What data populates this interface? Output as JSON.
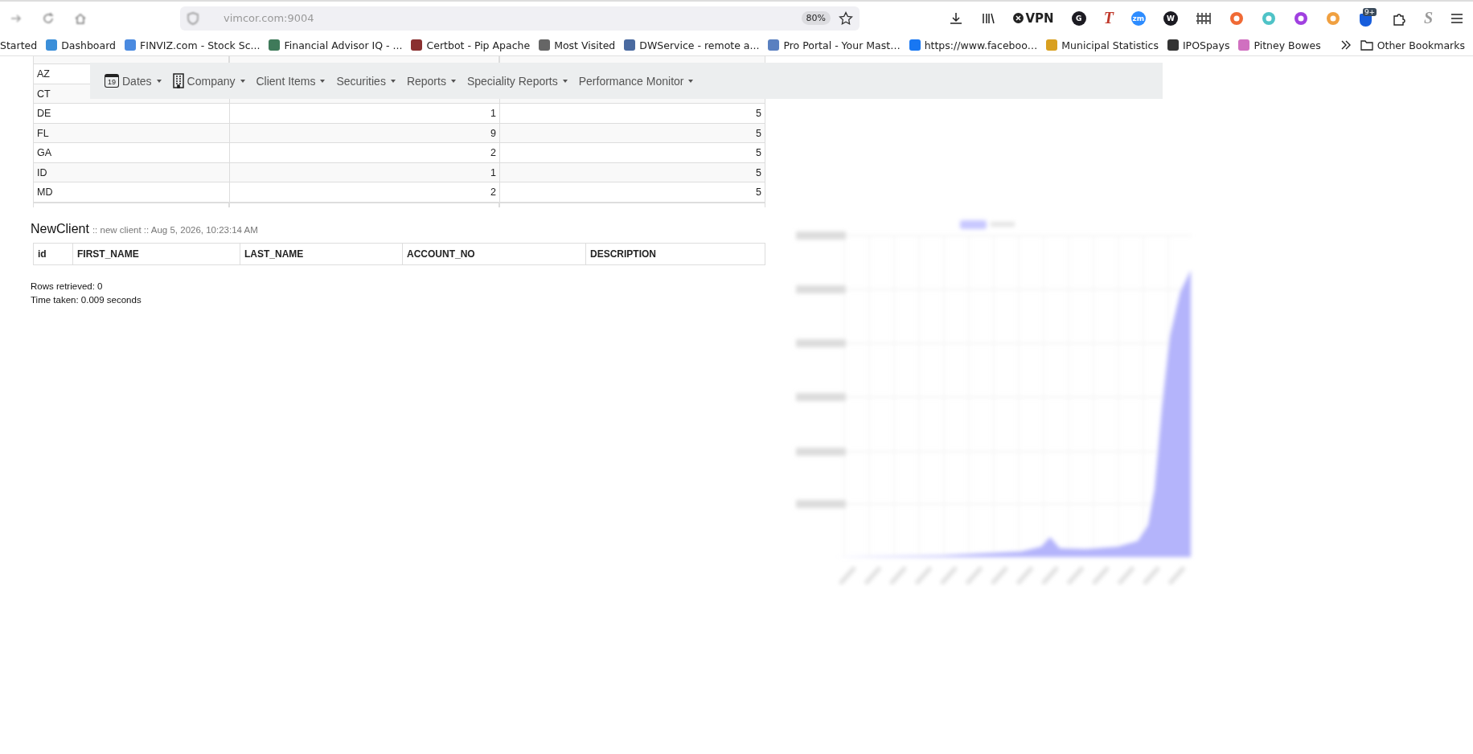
{
  "browser": {
    "address": "vimcor.com:9004",
    "zoom": "80%",
    "extensions": [
      {
        "kind": "download"
      },
      {
        "kind": "library"
      },
      {
        "kind": "vpn",
        "label": "VPN"
      },
      {
        "kind": "letter",
        "label": "G",
        "color": "#1c1b22"
      },
      {
        "kind": "serif",
        "label": "T",
        "color": "#c0392b"
      },
      {
        "kind": "letter",
        "label": "zm",
        "color": "#2d8cff"
      },
      {
        "kind": "letter",
        "label": "W",
        "color": "#1c1b22"
      },
      {
        "kind": "fence"
      },
      {
        "kind": "dot",
        "color": "#f06a35"
      },
      {
        "kind": "dot",
        "color": "#4fc3c7"
      },
      {
        "kind": "dot",
        "color": "#a040e0"
      },
      {
        "kind": "dot",
        "color": "#f0a040"
      },
      {
        "kind": "badge",
        "label": "9+",
        "color": "#175ddc"
      },
      {
        "kind": "puzzle"
      },
      {
        "kind": "serif",
        "label": "S",
        "color": "#9a9a9a"
      },
      {
        "kind": "menu"
      }
    ],
    "bookmarks": [
      {
        "label": "Started"
      },
      {
        "label": "Dashboard",
        "color": "#3b8fd9"
      },
      {
        "label": "FINVIZ.com - Stock Sc...",
        "color": "#4a8ae0"
      },
      {
        "label": "Financial Advisor IQ - ...",
        "color": "#3f7a5a"
      },
      {
        "label": "Certbot - Pip Apache",
        "color": "#8a3030"
      },
      {
        "label": "Most Visited",
        "color": "#666666"
      },
      {
        "label": "DWService - remote a...",
        "color": "#4a6aa0"
      },
      {
        "label": "Pro Portal - Your Mast…",
        "color": "#5a80c0"
      },
      {
        "label": "https://www.faceboo…",
        "color": "#1877f2"
      },
      {
        "label": "Municipal Statistics",
        "color": "#d9a020"
      },
      {
        "label": "IPOSpays",
        "color": "#333333"
      },
      {
        "label": "Pitney Bowes",
        "color": "#d070c0"
      }
    ],
    "other_bookmarks": "Other Bookmarks"
  },
  "navbar": [
    {
      "label": "Dates",
      "kind": "calendar",
      "icon_text": "19"
    },
    {
      "label": "Company",
      "kind": "building"
    },
    {
      "label": "Client Items",
      "kind": "plain"
    },
    {
      "label": "Securities",
      "kind": "plain"
    },
    {
      "label": "Reports",
      "kind": "plain"
    },
    {
      "label": "Speciality Reports",
      "kind": "plain"
    },
    {
      "label": "Performance Monitor",
      "kind": "plain"
    }
  ],
  "state_table": {
    "rows": [
      {
        "state": "AZ"
      },
      {
        "state": "CT"
      },
      {
        "state": "DE",
        "column_2": "1",
        "column_3": "5"
      },
      {
        "state": "FL",
        "column_2": "9",
        "column_3": "5"
      },
      {
        "state": "GA",
        "column_2": "2",
        "column_3": "5"
      },
      {
        "state": "ID",
        "column_2": "1",
        "column_3": "5"
      },
      {
        "state": "MD",
        "column_2": "2",
        "column_3": "5"
      }
    ]
  },
  "query": {
    "title": "NewClient",
    "meta": ":: new client :: Aug 5, 2026, 10:23:14 AM",
    "columns": [
      "id",
      "FIRST_NAME",
      "LAST_NAME",
      "ACCOUNT_NO",
      "DESCRIPTION"
    ],
    "rows_retrieved": "Rows retrieved: 0",
    "time_taken": "Time taken: 0.009 seconds"
  }
}
